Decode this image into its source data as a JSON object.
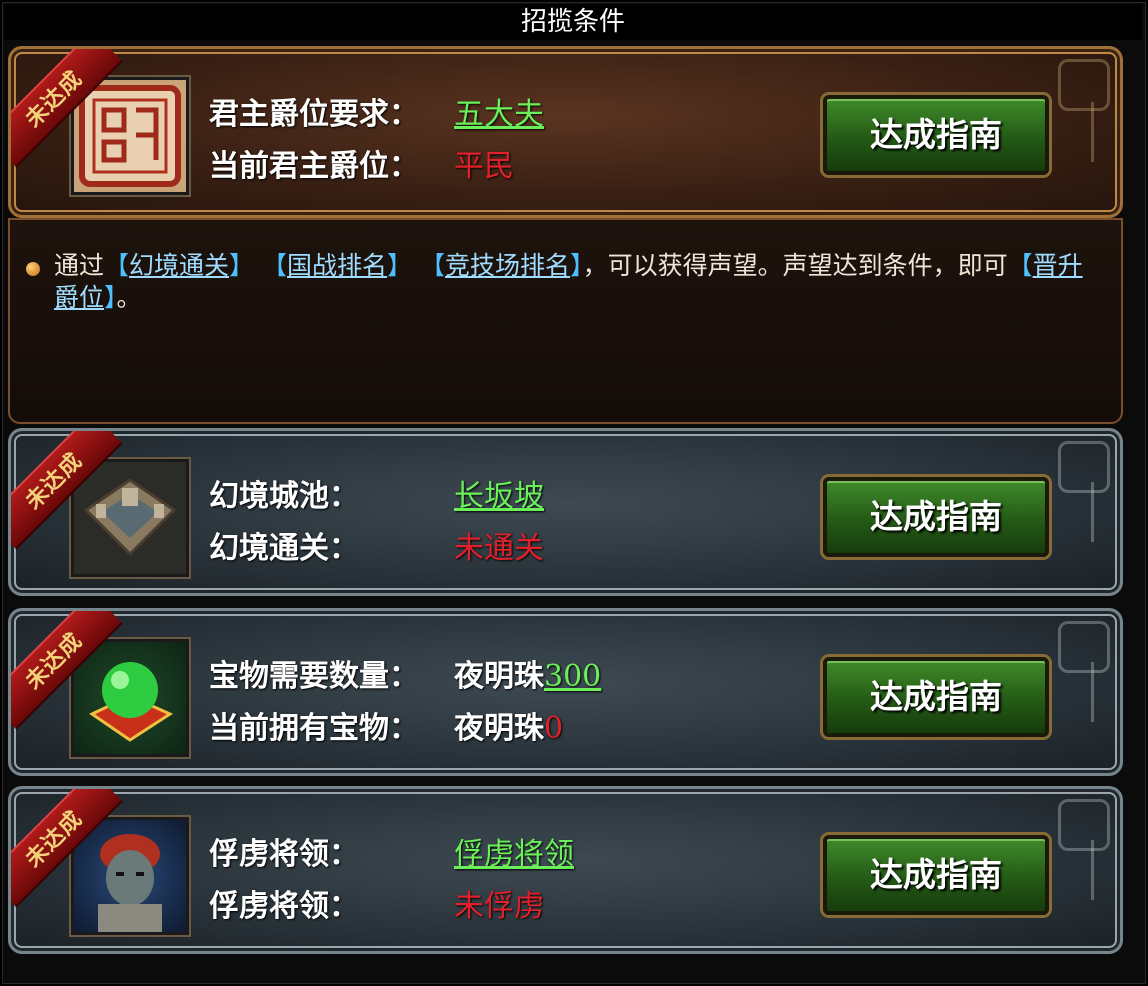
{
  "window": {
    "title": "招揽条件"
  },
  "status_ribbon": "未达成",
  "guide_button": "达成指南",
  "rank": {
    "required_label": "君主爵位要求：",
    "required_value": "五大夫",
    "current_label": "当前君主爵位：",
    "current_value": "平民",
    "icon": "seal-icon"
  },
  "info": {
    "prefix": "通过",
    "link1": "幻境通关",
    "link2": "国战排名",
    "link3": "竞技场排名",
    "middle": "，可以获得声望。声望达到条件，即可",
    "link4": "晋升爵位",
    "suffix": "。"
  },
  "conditions": [
    {
      "label1": "幻境城池：",
      "value1": "长坂坡",
      "label2": "幻境通关：",
      "value2": "未通关",
      "icon": "city-icon"
    },
    {
      "label1": "宝物需要数量：",
      "value1_prefix": "夜明珠",
      "value1_num": "300",
      "label2": "当前拥有宝物：",
      "value2_prefix": "夜明珠",
      "value2_num": "0",
      "icon": "pearl-icon"
    },
    {
      "label1": "俘虏将领：",
      "value1": "俘虏将领",
      "label2": "俘虏将领：",
      "value2": "未俘虏",
      "icon": "general-portrait-icon"
    }
  ],
  "colors": {
    "met": "#6bf05a",
    "unmet": "#e0202a",
    "link": "#4fc0ff"
  }
}
